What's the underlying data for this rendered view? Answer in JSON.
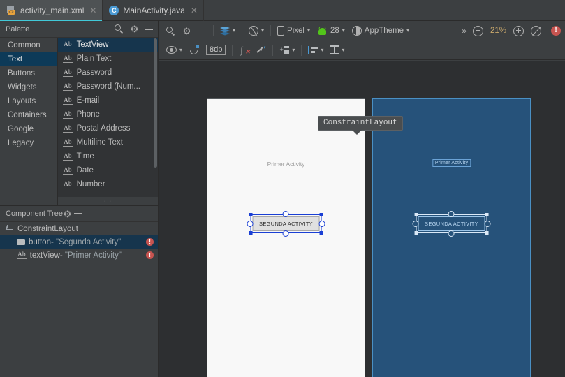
{
  "tabs": [
    {
      "label": "activity_main.xml",
      "icon": "xml-file-icon",
      "icon_text": "<>",
      "close": "✕",
      "active": true
    },
    {
      "label": "MainActivity.java",
      "icon": "java-class-icon",
      "icon_text": "C",
      "close": "✕",
      "active": false
    }
  ],
  "palette": {
    "title": "Palette",
    "search_icon": "search-icon",
    "gear_icon": "gear-icon",
    "minimize_icon": "minimize-icon",
    "categories": [
      {
        "label": "Common",
        "selected": false
      },
      {
        "label": "Text",
        "selected": true
      },
      {
        "label": "Buttons",
        "selected": false
      },
      {
        "label": "Widgets",
        "selected": false
      },
      {
        "label": "Layouts",
        "selected": false
      },
      {
        "label": "Containers",
        "selected": false
      },
      {
        "label": "Google",
        "selected": false
      },
      {
        "label": "Legacy",
        "selected": false
      }
    ],
    "items": [
      {
        "icon": "Ab",
        "label": "TextView",
        "selected": true
      },
      {
        "icon": "Ab",
        "label": "Plain Text",
        "selected": false
      },
      {
        "icon": "Ab",
        "label": "Password",
        "selected": false
      },
      {
        "icon": "Ab",
        "label": "Password (Num...",
        "selected": false
      },
      {
        "icon": "Ab",
        "label": "E-mail",
        "selected": false
      },
      {
        "icon": "Ab",
        "label": "Phone",
        "selected": false
      },
      {
        "icon": "Ab",
        "label": "Postal Address",
        "selected": false
      },
      {
        "icon": "Ab",
        "label": "Multiline Text",
        "selected": false
      },
      {
        "icon": "Ab",
        "label": "Time",
        "selected": false
      },
      {
        "icon": "Ab",
        "label": "Date",
        "selected": false
      },
      {
        "icon": "Ab",
        "label": "Number",
        "selected": false
      }
    ],
    "grip": "⁙⁙"
  },
  "component_tree": {
    "title": "Component Tree",
    "gear_icon": "gear-icon",
    "minimize_icon": "minimize-icon",
    "rows": [
      {
        "icon": "constraint-layout-icon",
        "label": "ConstraintLayout",
        "quoted": "",
        "selected": false,
        "error": false
      },
      {
        "icon": "button-icon",
        "label": "button- ",
        "quoted": "\"Segunda Activity\"",
        "selected": true,
        "error": true
      },
      {
        "icon": "textview-icon",
        "label": "textView- ",
        "quoted": "\"Primer Activity\"",
        "selected": false,
        "error": true
      }
    ],
    "error_glyph": "!"
  },
  "toolbar": {
    "search_icon": "search-icon",
    "gear_icon": "gear-icon",
    "minimize_icon": "minimize-icon",
    "layers_icon": "design-mode-icon",
    "orientation_icon": "orientation-icon",
    "device_icon": "device-icon",
    "device_label": "Pixel",
    "android_icon": "android-api-icon",
    "api_label": "28",
    "theme_icon": "theme-icon",
    "theme_label": "AppTheme",
    "overflow": "»",
    "zoom_out_icon": "zoom-out-icon",
    "zoom_level": "21%",
    "zoom_in_icon": "zoom-in-icon",
    "zoom_fit_icon": "zoom-to-fit-icon",
    "error_glyph": "!",
    "caret": "▾"
  },
  "constraint_toolbar": {
    "eye_icon": "show-constraints-icon",
    "magnet_icon": "autoconnect-icon",
    "margin_value": "8dp",
    "clear_constraints_icon": "clear-constraints-icon",
    "clear_glyph": "∫",
    "clear_x": "✕",
    "infer_icon": "infer-constraints-icon",
    "guideline_icon": "guidelines-icon",
    "guideline_plus": "+",
    "align_icon": "align-icon",
    "distribute_icon": "distribute-icon",
    "caret": "▾"
  },
  "canvas": {
    "design_view": {
      "name": "design-surface",
      "textview_label": "Primer Activity",
      "button_label": "SEGUNDA ACTIVITY"
    },
    "blueprint_view": {
      "name": "blueprint-surface",
      "textview_label": "Primer Activity",
      "button_label": "SEGUNDA ACTIVITY"
    },
    "tooltip": "ConstraintLayout"
  },
  "colors": {
    "accent_blue": "#4a90c4",
    "tab_underline": "#41c9d8",
    "error_red": "#c75450",
    "selection_navy": "#16354d",
    "blueprint_bg": "#26527a",
    "blueprint_stroke": "#4a90c4",
    "zoom_text": "#c9a86c",
    "android_green": "#52c41a",
    "selection_handle": "#1a3fd4"
  }
}
